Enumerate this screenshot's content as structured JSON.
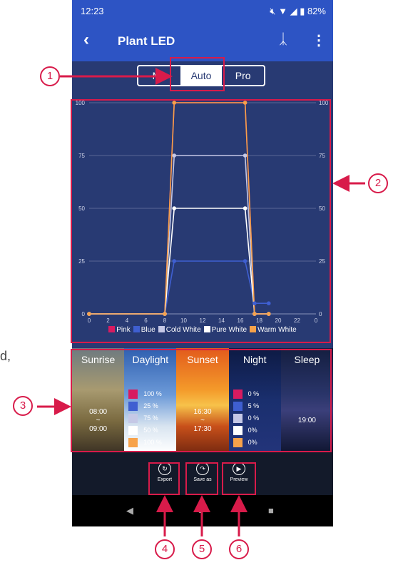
{
  "status": {
    "time": "12:23",
    "battery": "82%"
  },
  "appbar": {
    "title": "Plant LED",
    "back_icon": "chevron-left-icon",
    "bt_icon": "bluetooth-icon",
    "menu_icon": "more-vert-icon"
  },
  "modes": {
    "tabs": [
      "Me",
      "Auto",
      "Pro"
    ],
    "active": "Auto"
  },
  "chart_data": {
    "type": "line",
    "x_ticks": [
      "0",
      "2",
      "4",
      "6",
      "8",
      "10",
      "12",
      "14",
      "16",
      "18",
      "20",
      "22",
      "0"
    ],
    "y_ticks": [
      "0",
      "25",
      "50",
      "75",
      "100"
    ],
    "ylim": [
      0,
      100
    ],
    "x_hours": [
      0,
      8,
      9,
      16.5,
      17.5,
      19
    ],
    "series": [
      {
        "name": "Pink",
        "color": "#d81b60",
        "values": [
          0,
          0,
          100,
          100,
          0,
          0
        ]
      },
      {
        "name": "Blue",
        "color": "#3f5fd1",
        "values": [
          0,
          0,
          25,
          25,
          5,
          5
        ]
      },
      {
        "name": "Cold White",
        "color": "#c5c8e6",
        "values": [
          0,
          0,
          75,
          75,
          0,
          0
        ]
      },
      {
        "name": "Pure White",
        "color": "#ffffff",
        "values": [
          0,
          0,
          50,
          50,
          0,
          0
        ]
      },
      {
        "name": "Warm White",
        "color": "#f7a24a",
        "values": [
          0,
          0,
          100,
          100,
          0,
          0
        ]
      }
    ]
  },
  "scenes": [
    {
      "name": "Sunrise",
      "time_start": "08:00",
      "tilde": "~",
      "time_end": "09:00"
    },
    {
      "name": "Daylight",
      "percents": [
        "100 %",
        "25 %",
        "75 %",
        "50 %",
        "100 %"
      ]
    },
    {
      "name": "Sunset",
      "time_start": "16:30",
      "tilde": "~",
      "time_end": "17:30"
    },
    {
      "name": "Night",
      "percents": [
        "0 %",
        "5 %",
        "0 %",
        "0%",
        "0%"
      ]
    },
    {
      "name": "Sleep",
      "time": "19:00"
    }
  ],
  "swatch_colors": [
    "#d81b60",
    "#3f5fd1",
    "#c5c8e6",
    "#ffffff",
    "#f7a24a"
  ],
  "actions": [
    {
      "label": "Export",
      "icon": "export-icon"
    },
    {
      "label": "Save as",
      "icon": "save-as-icon"
    },
    {
      "label": "Preview",
      "icon": "play-icon"
    }
  ],
  "callouts": [
    "1",
    "2",
    "3",
    "4",
    "5",
    "6"
  ],
  "side_text": "d,",
  "accent": "#d81b4a"
}
